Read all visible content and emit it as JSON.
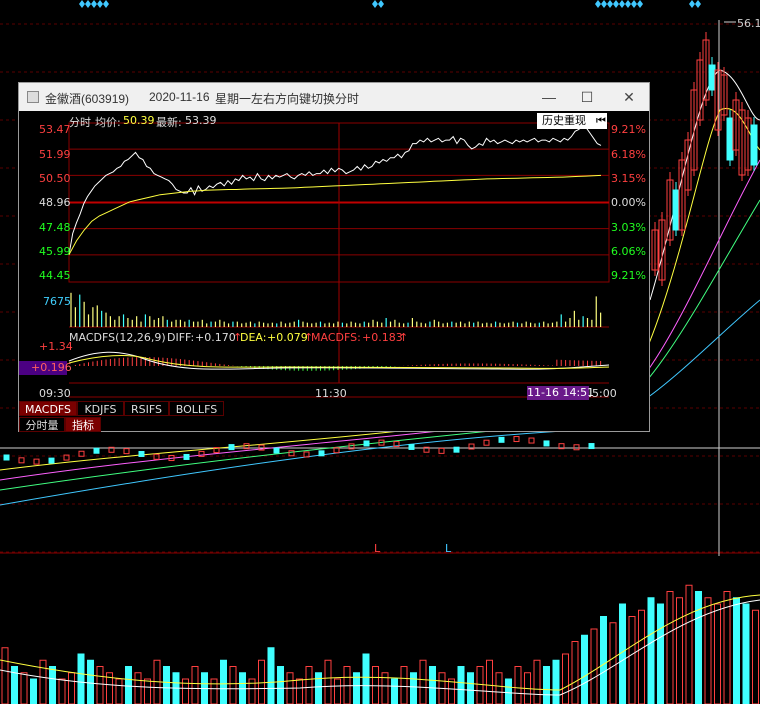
{
  "window": {
    "title": "金徽酒(603919)",
    "date": "2020-11-16",
    "weekday": "星期一",
    "hint": "左右方向键切换分时",
    "buttons": {
      "minimize": "—",
      "maximize": "☐",
      "close": "✕"
    }
  },
  "intraday": {
    "header_label": "分时",
    "avg_label": "均价:",
    "avg_value": "50.39",
    "latest_label": "最新:",
    "latest_value": "53.39",
    "history_button": "历史重现",
    "price_levels": [
      "53.47",
      "51.99",
      "50.50",
      "48.96",
      "47.48",
      "45.99",
      "44.45"
    ],
    "pct_levels": [
      "9.21%",
      "6.18%",
      "3.15%",
      "0.00%",
      "3.03%",
      "6.06%",
      "9.21%"
    ],
    "prev_close": 48.96,
    "volume_max_label": "7675",
    "time_start": "09:30",
    "time_mid": "11:30",
    "time_end": "15:00",
    "cursor_time": "11-16 14:51",
    "price_points": [
      46.0,
      47.2,
      47.8,
      48.3,
      48.9,
      49.3,
      49.6,
      49.9,
      50.1,
      50.3,
      50.5,
      50.6,
      50.7,
      50.9,
      51.0,
      51.3,
      51.4,
      51.6,
      51.8,
      51.5,
      51.4,
      51.0,
      50.9,
      50.6,
      50.5,
      50.4,
      50.3,
      50.2,
      50.0,
      49.7,
      49.6,
      49.5,
      49.5,
      49.8,
      49.4,
      49.9,
      49.6,
      49.7,
      49.9,
      49.8,
      50.0,
      50.1,
      49.9,
      50.2,
      50.0,
      50.3,
      50.2,
      50.5,
      50.3,
      50.4,
      50.2,
      50.6,
      50.3,
      50.2,
      50.5,
      50.3,
      50.5,
      50.4,
      50.5,
      50.6,
      50.4,
      50.3,
      50.5,
      50.6,
      50.5,
      50.7,
      50.5,
      50.6,
      50.6,
      50.8,
      50.6,
      50.9,
      50.7,
      50.9,
      50.8,
      50.6,
      50.7,
      50.8,
      51.0,
      50.8,
      51.1,
      50.9,
      51.0,
      51.3,
      51.2,
      51.4,
      51.3,
      51.5,
      51.5,
      51.7,
      51.5,
      51.8,
      51.9,
      52.3,
      52.3,
      52.5,
      52.4,
      52.6,
      52.4,
      52.5,
      52.6,
      52.4,
      52.5,
      52.5,
      52.7,
      52.3,
      52.6,
      52.5,
      52.2,
      52.0,
      52.1,
      52.3,
      52.2,
      52.6,
      52.4,
      52.5,
      52.3,
      52.4,
      52.5,
      52.4,
      52.3,
      52.5,
      52.4,
      52.5,
      52.4,
      52.5,
      52.6,
      52.4,
      52.5,
      52.5,
      52.4,
      52.6,
      52.5,
      52.4,
      52.6,
      52.5,
      52.7,
      53.0,
      53.1,
      53.3,
      53.2,
      52.9,
      52.6,
      52.3,
      52.2
    ],
    "avg_points": [
      46.0,
      46.8,
      47.4,
      47.9,
      48.2,
      48.4,
      48.6,
      48.8,
      49.0,
      49.1,
      49.2,
      49.3,
      49.4,
      49.45,
      49.5,
      49.55,
      49.6,
      49.62,
      49.65,
      49.67,
      49.68,
      49.7,
      49.7,
      49.72,
      49.73,
      49.74,
      49.75,
      49.76,
      49.77,
      49.78,
      49.8,
      49.82,
      49.84,
      49.86,
      49.88,
      49.9,
      49.92,
      49.94,
      49.96,
      49.98,
      50.0,
      50.02,
      50.04,
      50.06,
      50.08,
      50.1,
      50.12,
      50.14,
      50.16,
      50.18,
      50.2,
      50.22,
      50.24,
      50.26,
      50.28,
      50.3,
      50.31,
      50.32,
      50.33,
      50.34,
      50.35,
      50.36,
      50.37,
      50.38,
      50.39,
      50.4,
      50.42,
      50.44,
      50.46,
      50.48,
      50.5
    ],
    "volume_bars": [
      0.95,
      0.55,
      0.9,
      0.7,
      0.35,
      0.55,
      0.6,
      0.45,
      0.4,
      0.3,
      0.2,
      0.3,
      0.35,
      0.25,
      0.2,
      0.3,
      0.15,
      0.35,
      0.3,
      0.2,
      0.25,
      0.3,
      0.2,
      0.15,
      0.2,
      0.2,
      0.15,
      0.2,
      0.15,
      0.15,
      0.2,
      0.1,
      0.15,
      0.15,
      0.2,
      0.15,
      0.1,
      0.15,
      0.15,
      0.1,
      0.12,
      0.15,
      0.1,
      0.15,
      0.12,
      0.1,
      0.12,
      0.1,
      0.15,
      0.1,
      0.12,
      0.15,
      0.2,
      0.15,
      0.12,
      0.1,
      0.12,
      0.15,
      0.1,
      0.12,
      0.1,
      0.15,
      0.12,
      0.1,
      0.15,
      0.12,
      0.1,
      0.15,
      0.12,
      0.2,
      0.15,
      0.12,
      0.25,
      0.15,
      0.2,
      0.12,
      0.1,
      0.12,
      0.25,
      0.15,
      0.12,
      0.1,
      0.15,
      0.2,
      0.15,
      0.1,
      0.12,
      0.15,
      0.12,
      0.15,
      0.1,
      0.15,
      0.12,
      0.15,
      0.1,
      0.12,
      0.1,
      0.15,
      0.12,
      0.1,
      0.12,
      0.15,
      0.12,
      0.1,
      0.15,
      0.12,
      0.1,
      0.12,
      0.15,
      0.1,
      0.12,
      0.15,
      0.35,
      0.15,
      0.25,
      0.45,
      0.2,
      0.3,
      0.25,
      0.2,
      0.85,
      0.4
    ],
    "macd": {
      "header": "MACDFS(12,26,9)",
      "diff_label": "DIFF:",
      "diff_value": "+0.170",
      "dea_label": "DEA:",
      "dea_value": "+0.079",
      "macdfs_label": "MACDFS:",
      "macdfs_value": "+0.183",
      "arrow": "↑",
      "upper_label": "+1.34",
      "cursor_label": "+0.196"
    },
    "indicator_tabs": [
      "MACDFS",
      "KDJFS",
      "RSIFS",
      "BOLLFS"
    ],
    "bottom_tabs": [
      "分时量",
      "指标"
    ]
  },
  "background": {
    "top_price_label": "56.1",
    "markers": [
      "L",
      "L"
    ]
  }
}
